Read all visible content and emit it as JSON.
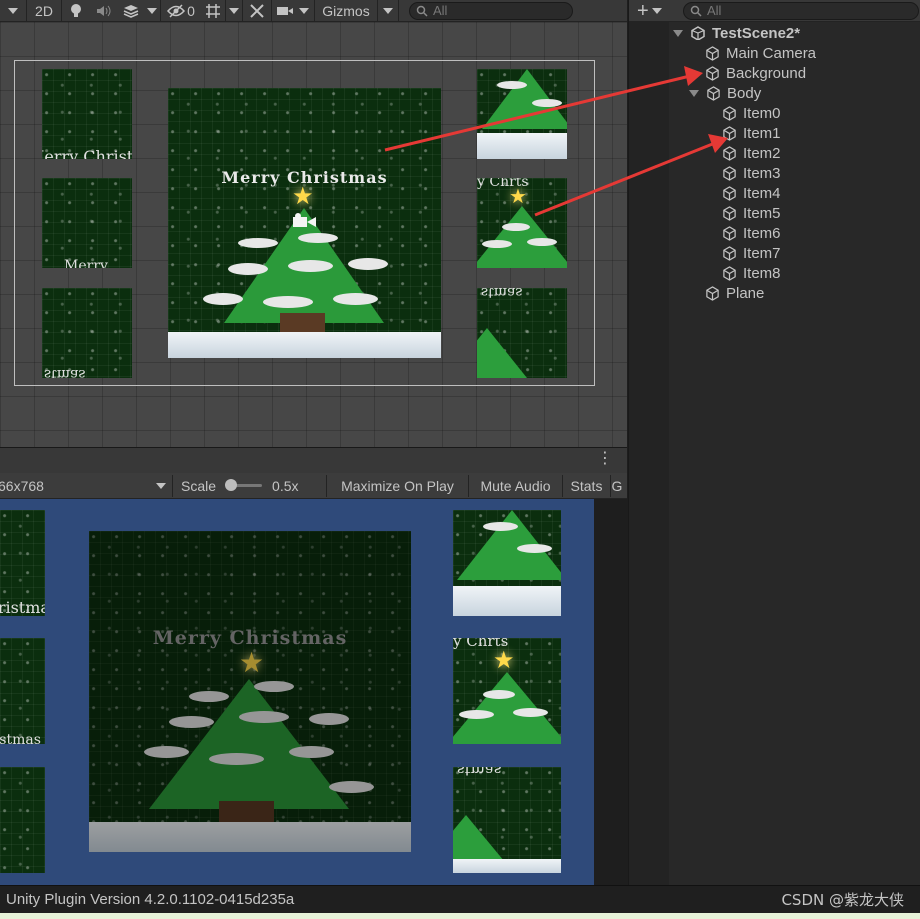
{
  "scene_toolbar": {
    "mode_2d": "2D",
    "hidden_count": "0",
    "gizmos": "Gizmos",
    "search_placeholder": "All"
  },
  "scene_art": {
    "main_title": "Merry Christmas",
    "fragment_left_1": "Merry Christmas",
    "fragment_left_2": "Merry",
    "fragment_left_3": "stmas",
    "fragment_right_2": "y Chrts",
    "fragment_right_3": "stmas"
  },
  "game_toolbar": {
    "resolution": "66x768",
    "scale_label": "Scale",
    "scale_value": "0.5x",
    "scale_level": 0.15,
    "maximize": "Maximize On Play",
    "mute": "Mute Audio",
    "stats": "Stats",
    "gizmos_cut": "G"
  },
  "game_art": {
    "main_title": "Merry Christmas",
    "fragment_left_1": "Merry Christmas",
    "fragment_left_2": "Merry Christmas",
    "fragment_right_2": "y Chrts",
    "fragment_right_3": "stmas"
  },
  "hierarchy": {
    "search_placeholder": "All",
    "scene_name": "TestScene2*",
    "items": {
      "main_camera": "Main Camera",
      "background": "Background",
      "body": "Body",
      "item0": "Item0",
      "item1": "Item1",
      "item2": "Item2",
      "item3": "Item3",
      "item4": "Item4",
      "item5": "Item5",
      "item6": "Item6",
      "item7": "Item7",
      "item8": "Item8",
      "plane": "Plane"
    }
  },
  "status_bar": {
    "plugin_version": "Unity Plugin Version 4.2.0.1102-0415d235a",
    "watermark": "CSDN @紫龙大侠"
  },
  "colors": {
    "annotation_arrow": "#e53935",
    "game_background": "#2f4a7a"
  }
}
